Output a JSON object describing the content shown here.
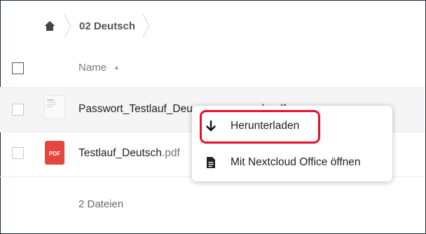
{
  "breadcrumb": {
    "home_icon": "home-icon",
    "folder": "02 Deutsch"
  },
  "table": {
    "name_header": "Name",
    "sort_icon": "sort-ascending-icon",
    "files": [
      {
        "name": "Passwort_Testlauf_Deutsch.pdf",
        "visible_name": "Passwort_Testlauf_Deu",
        "visible_tail": "rch.pdf",
        "thumb": "document-thumbnail-icon"
      },
      {
        "name_base": "Testlauf_Deutsch",
        "name_ext": ".pdf",
        "thumb": "pdf-file-icon",
        "thumb_label": "PDF"
      }
    ],
    "summary": "2 Dateien"
  },
  "context_menu": {
    "items": [
      {
        "label": "Herunterladen",
        "icon": "download-icon",
        "highlighted": true
      },
      {
        "label": "Mit Nextcloud Office öffnen",
        "icon": "document-icon"
      }
    ]
  },
  "colors": {
    "highlight": "#e8102a",
    "pdf_red": "#e5473d"
  }
}
